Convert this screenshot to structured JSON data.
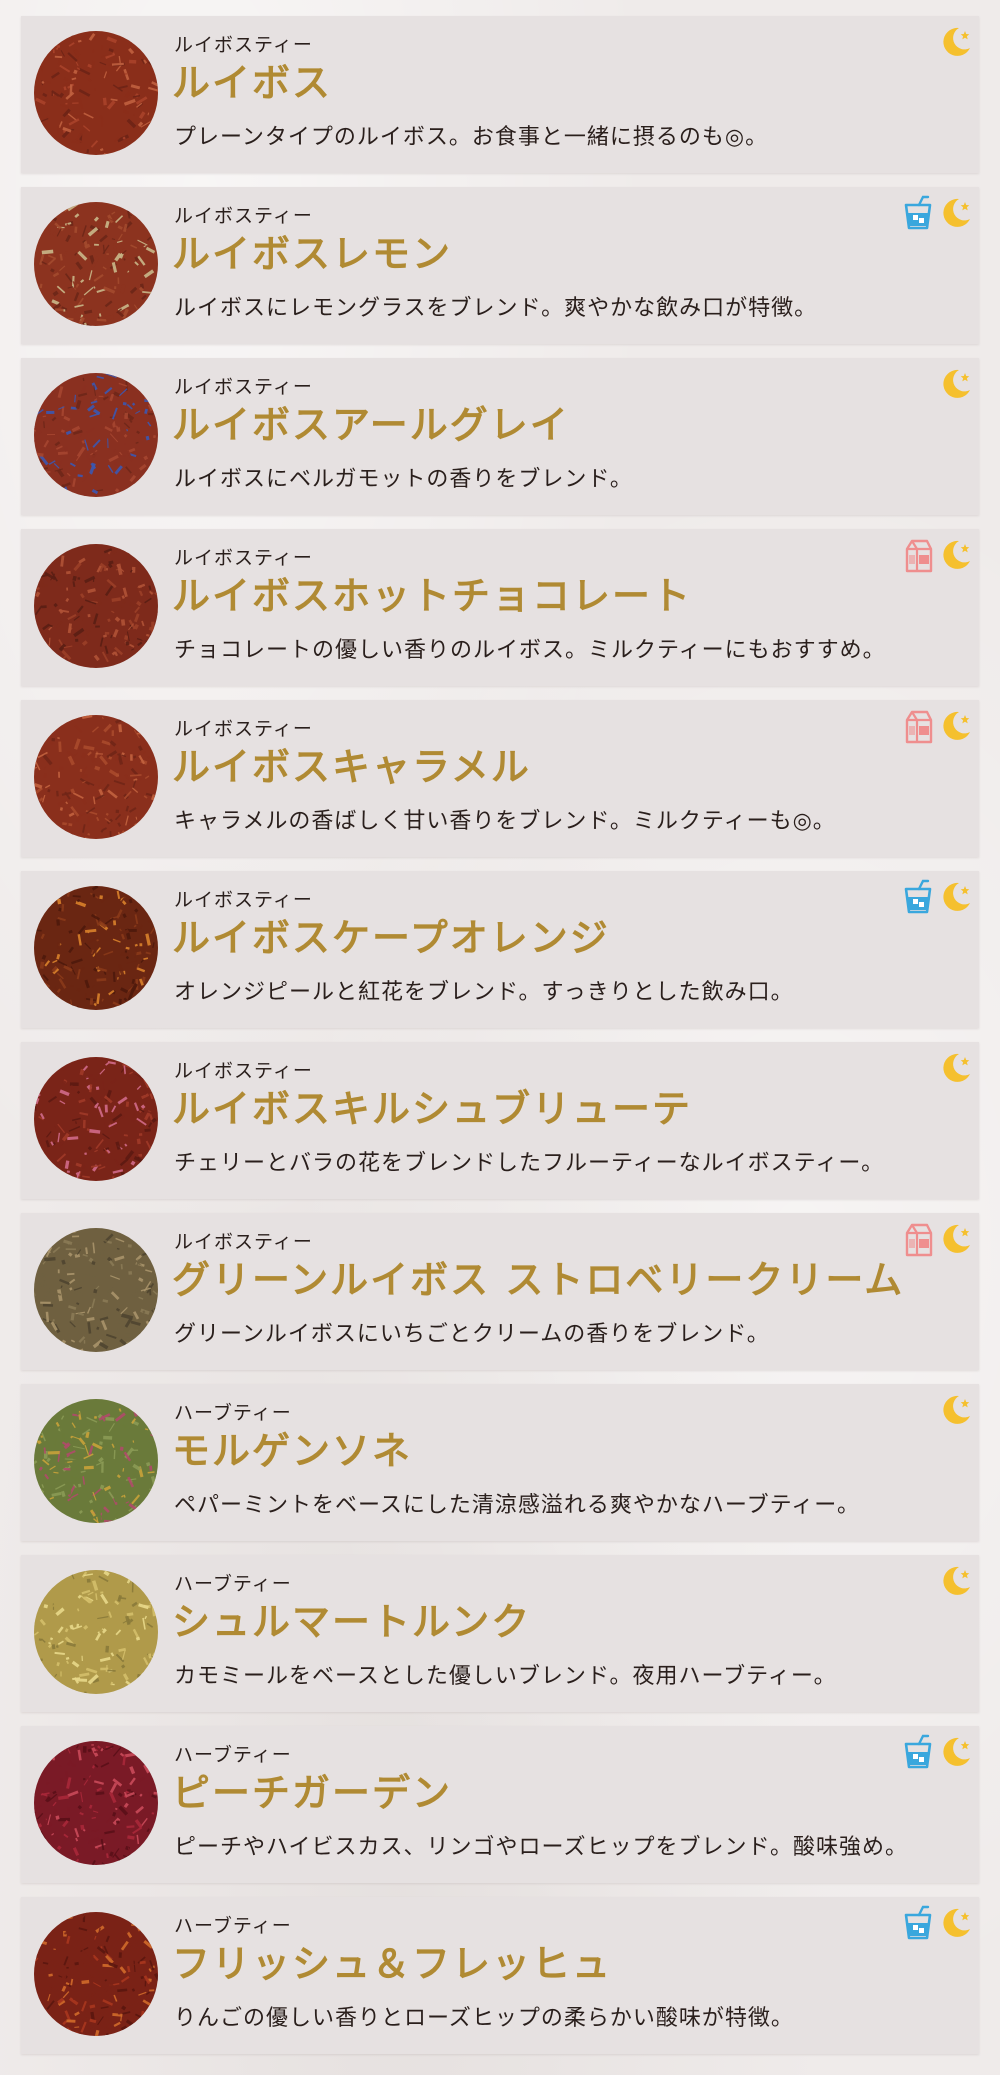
{
  "colors": {
    "card_bg": "#e6e1e1",
    "name_gold": "#b08a33",
    "text_dark": "#2a1f1c",
    "moon_yellow": "#f5c02e",
    "iced_blue": "#3aa7dd",
    "milk_pink": "#ef8e8e"
  },
  "items": [
    {
      "category": "ルイボスティー",
      "name": "ルイボス",
      "description": "プレーンタイプのルイボス。お食事と一緒に摂るのも◎。",
      "icons": [
        "moon-icon"
      ],
      "swatch": [
        "#8a2e1a",
        "#a8432a",
        "#6d2416",
        "#c0603f"
      ]
    },
    {
      "category": "ルイボスティー",
      "name": "ルイボスレモン",
      "description": "ルイボスにレモングラスをブレンド。爽やかな飲み口が特徴。",
      "icons": [
        "iced-drink-icon",
        "moon-icon"
      ],
      "swatch": [
        "#8c331f",
        "#a34a2d",
        "#c9b88a",
        "#6b2617"
      ]
    },
    {
      "category": "ルイボスティー",
      "name": "ルイボスアールグレイ",
      "description": "ルイボスにベルガモットの香りをブレンド。",
      "icons": [
        "moon-icon"
      ],
      "swatch": [
        "#8a3020",
        "#a54630",
        "#3b58b0",
        "#6e2718"
      ]
    },
    {
      "category": "ルイボスティー",
      "name": "ルイボスホットチョコレート",
      "description": "チョコレートの優しい香りのルイボス。ミルクティーにもおすすめ。",
      "icons": [
        "milk-carton-icon",
        "moon-icon"
      ],
      "swatch": [
        "#7e2a1b",
        "#9b3f28",
        "#5a1e14",
        "#b05236"
      ]
    },
    {
      "category": "ルイボスティー",
      "name": "ルイボスキャラメル",
      "description": "キャラメルの香ばしく甘い香りをブレンド。ミルクティーも◎。",
      "icons": [
        "milk-carton-icon",
        "moon-icon"
      ],
      "swatch": [
        "#8a2f1c",
        "#a94a2c",
        "#702617",
        "#c2633f"
      ]
    },
    {
      "category": "ルイボスティー",
      "name": "ルイボスケープオレンジ",
      "description": "オレンジピールと紅花をブレンド。すっきりとした飲み口。",
      "icons": [
        "iced-drink-icon",
        "moon-icon"
      ],
      "swatch": [
        "#6a2612",
        "#8a3a1a",
        "#d9822b",
        "#4e1a0c"
      ]
    },
    {
      "category": "ルイボスティー",
      "name": "ルイボスキルシュブリューテ",
      "description": "チェリーとバラの花をブレンドしたフルーティーなルイボスティー。",
      "icons": [
        "moon-icon"
      ],
      "swatch": [
        "#7a2418",
        "#a03a28",
        "#d06a8a",
        "#5c1a12"
      ]
    },
    {
      "category": "ルイボスティー",
      "name": "グリーンルイボス ストロベリークリーム",
      "description": "グリーンルイボスにいちごとクリームの香りをブレンド。",
      "icons": [
        "milk-carton-icon",
        "moon-icon"
      ],
      "swatch": [
        "#6f6040",
        "#8a7a55",
        "#4f4530",
        "#a8946a"
      ]
    },
    {
      "category": "ハーブティー",
      "name": "モルゲンソネ",
      "description": "ペパーミントをベースにした清涼感溢れる爽やかなハーブティー。",
      "icons": [
        "moon-icon"
      ],
      "swatch": [
        "#6a7a3a",
        "#8b9a55",
        "#c9a23a",
        "#b04a6a"
      ]
    },
    {
      "category": "ハーブティー",
      "name": "シュルマートルンク",
      "description": "カモミールをベースとした優しいブレンド。夜用ハーブティー。",
      "icons": [
        "moon-icon"
      ],
      "swatch": [
        "#b09a4a",
        "#d4bf6a",
        "#8a7a3a",
        "#e8d88a"
      ]
    },
    {
      "category": "ハーブティー",
      "name": "ピーチガーデン",
      "description": "ピーチやハイビスカス、リンゴやローズヒップをブレンド。酸味強め。",
      "icons": [
        "iced-drink-icon",
        "moon-icon"
      ],
      "swatch": [
        "#7a1a26",
        "#a8283a",
        "#5a1018",
        "#c94a5a"
      ]
    },
    {
      "category": "ハーブティー",
      "name": "フリッシュ＆フレッヒュ",
      "description": "りんごの優しい香りとローズヒップの柔らかい酸味が特徴。",
      "icons": [
        "iced-drink-icon",
        "moon-icon"
      ],
      "swatch": [
        "#7a2216",
        "#a8361e",
        "#d06a2a",
        "#5a160e"
      ]
    }
  ]
}
